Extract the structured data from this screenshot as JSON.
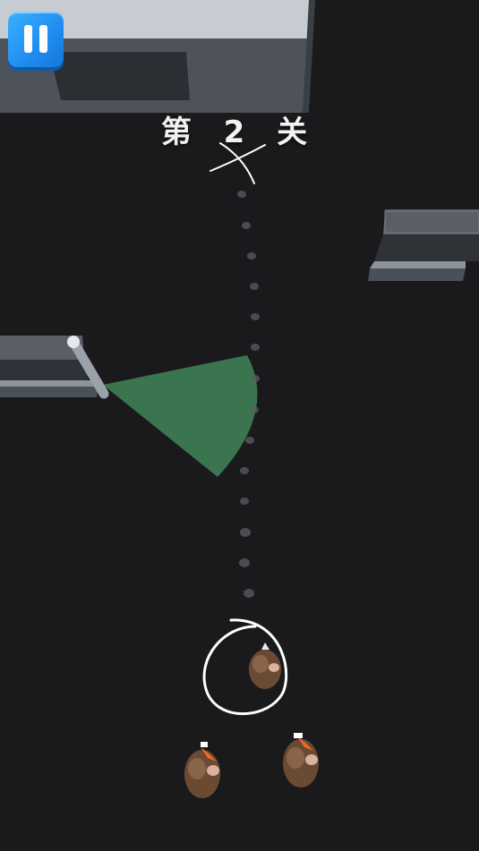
{
  "hud": {
    "pause_icon": "pause-icon",
    "level_label": "第 2 关"
  },
  "colors": {
    "background": "#1a1a1c",
    "vision_cone": "#3d7a52",
    "pause_button": "#2a9df4",
    "path_line": "#ffffff"
  },
  "entities": {
    "player_character": "guard-character-icon",
    "enemies": [
      "guard-character-icon",
      "guard-character-icon"
    ],
    "camera": "security-camera-icon"
  }
}
